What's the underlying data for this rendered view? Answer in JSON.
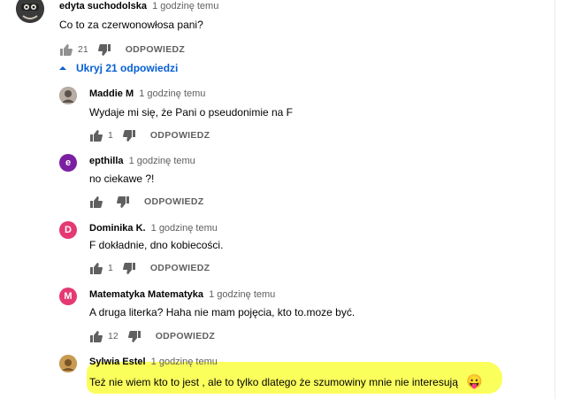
{
  "top_comment": {
    "author": "edyta suchodolska",
    "time": "1 godzinę temu",
    "text": "Co to za czerwonowłosa pani?",
    "likes": "21",
    "reply_label": "ODPOWIEDZ"
  },
  "replies_toggle": {
    "label": "Ukryj 21 odpowiedzi"
  },
  "replies": [
    {
      "author": "Maddie M",
      "time": "1 godzinę temu",
      "text": "Wydaje mi się, że Pani o pseudonimie na F",
      "likes": "1",
      "reply_label": "ODPOWIEDZ",
      "avatar_letter": "",
      "avatar_color": "#8a7f76"
    },
    {
      "author": "epthilla",
      "time": "1 godzinę temu",
      "text": "no ciekawe ?!",
      "likes": "",
      "reply_label": "ODPOWIEDZ",
      "avatar_letter": "e",
      "avatar_color": "#7b1fa2"
    },
    {
      "author": "Dominika K.",
      "time": "1 godzinę temu",
      "text": "F dokładnie, dno kobiecości.",
      "likes": "1",
      "reply_label": "ODPOWIEDZ",
      "avatar_letter": "D",
      "avatar_color": "#e53973"
    },
    {
      "author": "Matematyka Matematyka",
      "time": "1 godzinę temu",
      "text": "A druga literka? Haha nie mam pojęcia, kto to.moze być.",
      "likes": "12",
      "reply_label": "ODPOWIEDZ",
      "avatar_letter": "M",
      "avatar_color": "#e53973"
    },
    {
      "author": "Sylwia Estel",
      "time": "1 godzinę temu",
      "text": "Też nie wiem kto to jest , ale to tylko dlatego że szumowiny mnie nie interesują",
      "emoji": "😛",
      "avatar_letter": "",
      "avatar_color": "#a07a3c"
    }
  ],
  "colors": {
    "link": "#065fd4",
    "highlight": "#fbff4a",
    "meta": "#606060"
  }
}
